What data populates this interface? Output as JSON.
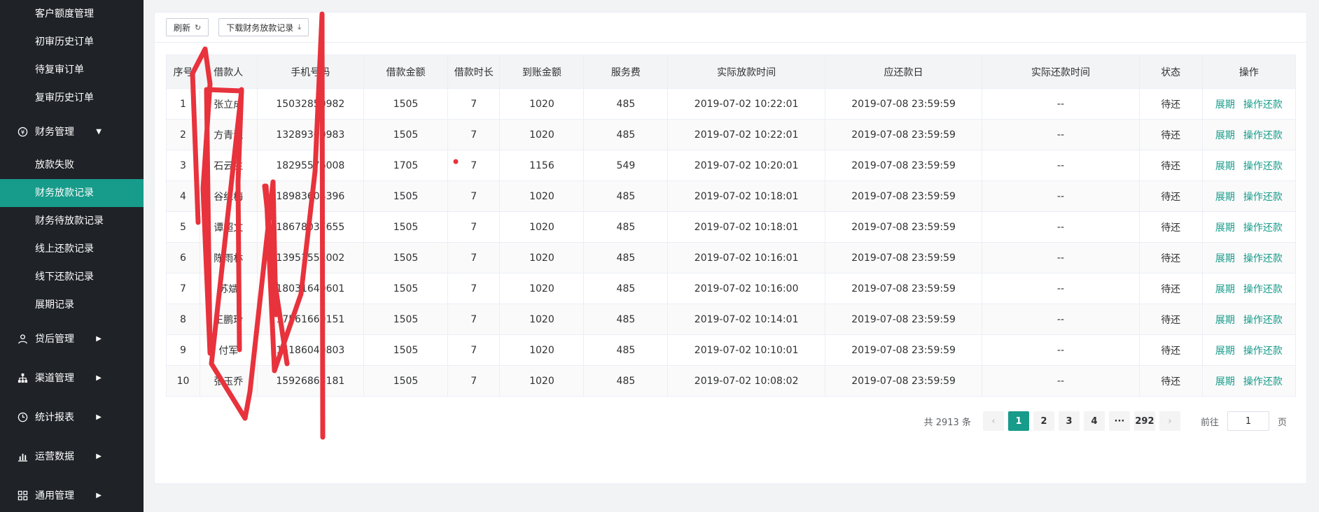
{
  "sidebar": {
    "top_items": [
      "客户额度管理",
      "初审历史订单",
      "待复审订单",
      "复审历史订单"
    ],
    "finance_group": "财务管理",
    "finance_items": [
      "放款失败",
      "财务放款记录",
      "财务待放款记录",
      "线上还款记录",
      "线下还款记录",
      "展期记录"
    ],
    "active_item": "财务放款记录",
    "groups": [
      {
        "label": "贷后管理",
        "icon": "user-icon"
      },
      {
        "label": "渠道管理",
        "icon": "org-chart-icon"
      },
      {
        "label": "统计报表",
        "icon": "clock-icon"
      },
      {
        "label": "运营数据",
        "icon": "bar-chart-icon"
      },
      {
        "label": "通用管理",
        "icon": "grid-icon"
      }
    ]
  },
  "toolbar": {
    "refresh_label": "刷新",
    "download_label": "下载财务放款记录"
  },
  "table": {
    "headers": [
      "序号",
      "借款人",
      "手机号码",
      "借款金额",
      "借款时长",
      "到账金额",
      "服务费",
      "实际放款时间",
      "应还款日",
      "实际还款时间",
      "状态",
      "操作"
    ],
    "rows": [
      [
        "1",
        "张立成",
        "15032850982",
        "1505",
        "7",
        "1020",
        "485",
        "2019-07-02 10:22:01",
        "2019-07-08 23:59:59",
        "--",
        "待还"
      ],
      [
        "2",
        "方青江",
        "13289300983",
        "1505",
        "7",
        "1020",
        "485",
        "2019-07-02 10:22:01",
        "2019-07-08 23:59:59",
        "--",
        "待还"
      ],
      [
        "3",
        "石云生",
        "18295576008",
        "1705",
        "7",
        "1156",
        "549",
        "2019-07-02 10:20:01",
        "2019-07-08 23:59:59",
        "--",
        "待还"
      ],
      [
        "4",
        "谷红梅",
        "18983604396",
        "1505",
        "7",
        "1020",
        "485",
        "2019-07-02 10:18:01",
        "2019-07-08 23:59:59",
        "--",
        "待还"
      ],
      [
        "5",
        "谭超文",
        "18678037655",
        "1505",
        "7",
        "1020",
        "485",
        "2019-07-02 10:18:01",
        "2019-07-08 23:59:59",
        "--",
        "待还"
      ],
      [
        "6",
        "陈雨林",
        "13951551002",
        "1505",
        "7",
        "1020",
        "485",
        "2019-07-02 10:16:01",
        "2019-07-08 23:59:59",
        "--",
        "待还"
      ],
      [
        "7",
        "苏斌",
        "18031640601",
        "1505",
        "7",
        "1020",
        "485",
        "2019-07-02 10:16:00",
        "2019-07-08 23:59:59",
        "--",
        "待还"
      ],
      [
        "8",
        "王鹏玲",
        "17561669151",
        "1505",
        "7",
        "1020",
        "485",
        "2019-07-02 10:14:01",
        "2019-07-08 23:59:59",
        "--",
        "待还"
      ],
      [
        "9",
        "付军",
        "15186040803",
        "1505",
        "7",
        "1020",
        "485",
        "2019-07-02 10:10:01",
        "2019-07-08 23:59:59",
        "--",
        "待还"
      ],
      [
        "10",
        "张玉乔",
        "15926868181",
        "1505",
        "7",
        "1020",
        "485",
        "2019-07-02 10:08:02",
        "2019-07-08 23:59:59",
        "--",
        "待还"
      ]
    ],
    "op_extend": "展期",
    "op_repay": "操作还款"
  },
  "pager": {
    "total": "共 2913 条",
    "prev": "‹",
    "next": "›",
    "pages": [
      "1",
      "2",
      "3",
      "4",
      "···",
      "292"
    ],
    "goto_label": "前往",
    "goto_value": "1",
    "unit": "页"
  },
  "colors": {
    "accent": "#179b8a",
    "sidebar_bg": "#1f2227",
    "scribble": "#e8323c"
  }
}
